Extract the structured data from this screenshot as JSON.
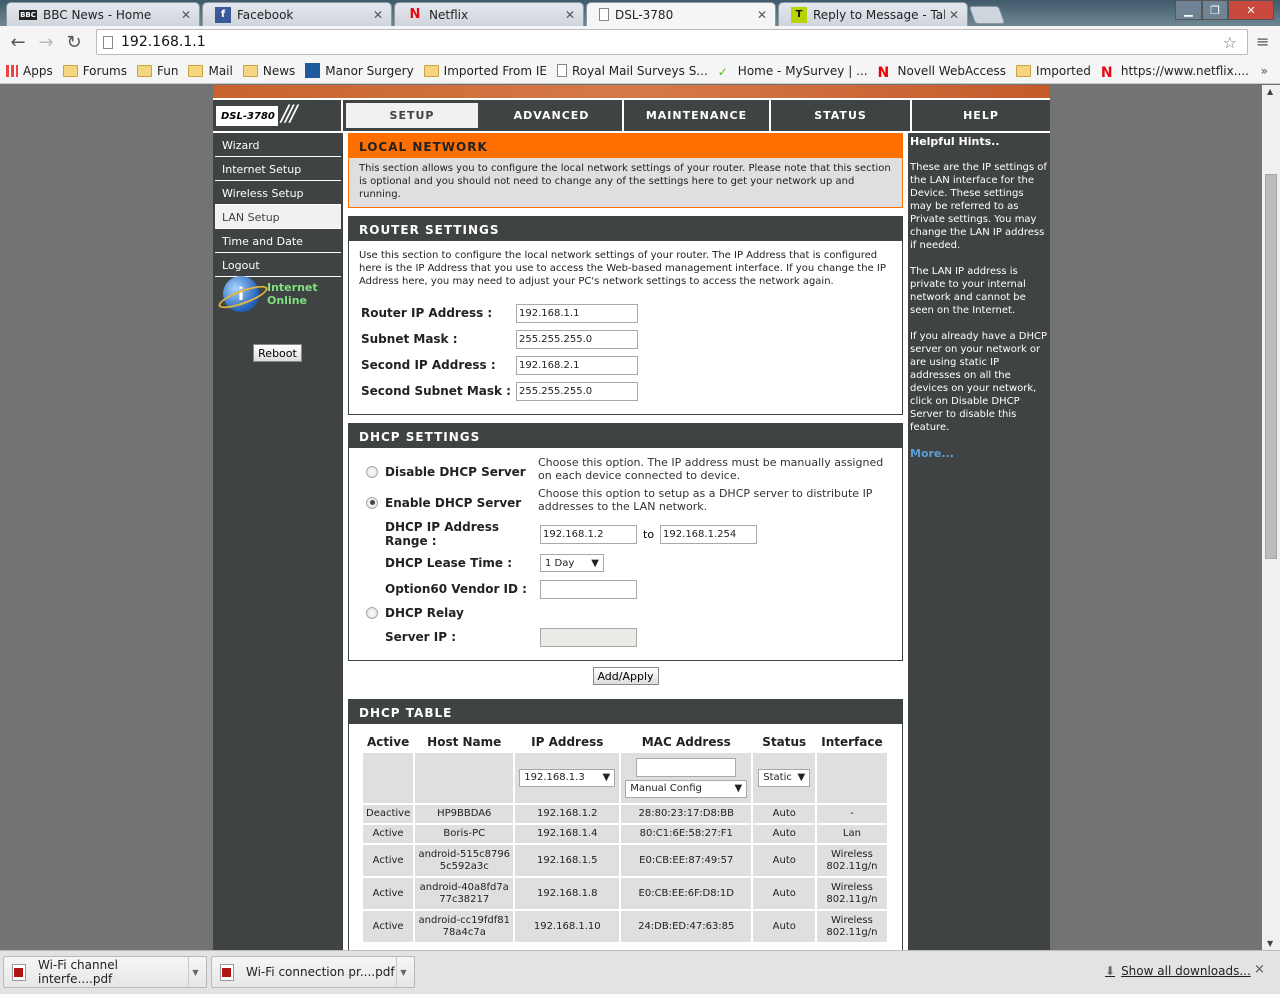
{
  "browser": {
    "tabs": [
      {
        "label": "BBC News - Home",
        "icon": "bbc-icon"
      },
      {
        "label": "Facebook",
        "icon": "facebook-icon"
      },
      {
        "label": "Netflix",
        "icon": "netflix-icon"
      },
      {
        "label": "DSL-3780",
        "icon": "page-icon",
        "active": true
      },
      {
        "label": "Reply to Message - TalkTa",
        "icon": "talktalk-icon"
      }
    ],
    "address": "192.168.1.1",
    "bookmarks": [
      {
        "label": "Apps",
        "icon": "apps-grid-icon"
      },
      {
        "label": "Forums",
        "icon": "folder-icon"
      },
      {
        "label": "Fun",
        "icon": "folder-icon"
      },
      {
        "label": "Mail",
        "icon": "folder-icon"
      },
      {
        "label": "News",
        "icon": "folder-icon"
      },
      {
        "label": "Manor Surgery",
        "icon": "surgery-icon"
      },
      {
        "label": "Imported From IE",
        "icon": "folder-icon"
      },
      {
        "label": "Royal Mail Surveys S...",
        "icon": "page-icon"
      },
      {
        "label": "Home - MySurvey | ...",
        "icon": "checkmark-icon"
      },
      {
        "label": "Novell WebAccess",
        "icon": "novell-icon"
      },
      {
        "label": "Imported",
        "icon": "folder-icon"
      },
      {
        "label": "https://www.netflix....",
        "icon": "netflix-icon"
      }
    ],
    "bookmarks_more": "»"
  },
  "router": {
    "model": "DSL-3780",
    "slashes": "///",
    "nav": [
      {
        "label": "SETUP",
        "active": true
      },
      {
        "label": "ADVANCED"
      },
      {
        "label": "MAINTENANCE"
      },
      {
        "label": "STATUS"
      },
      {
        "label": "HELP"
      }
    ],
    "sidebar": [
      {
        "label": "Wizard"
      },
      {
        "label": "Internet Setup"
      },
      {
        "label": "Wireless Setup"
      },
      {
        "label": "LAN Setup",
        "active": true
      },
      {
        "label": "Time and Date"
      },
      {
        "label": "Logout"
      }
    ],
    "status_line1": "Internet",
    "status_line2": "Online",
    "status_icon_glyph": "i",
    "reboot_label": "Reboot",
    "local_network": {
      "title": "LOCAL NETWORK",
      "desc": "This section allows you to configure the local network settings of your router. Please note that this section is optional and you should not need to change any of the settings here to get your network up and running."
    },
    "router_settings": {
      "title": "ROUTER SETTINGS",
      "desc": "Use this section to configure the local network settings of your router. The IP Address that is configured here is the IP Address that you use to access the Web-based management interface. If you change the IP Address here, you may need to adjust your PC's network settings to access the network again.",
      "fields": [
        {
          "label": "Router IP Address :",
          "value": "192.168.1.1"
        },
        {
          "label": "Subnet Mask :",
          "value": "255.255.255.0"
        },
        {
          "label": "Second IP Address :",
          "value": "192.168.2.1"
        },
        {
          "label": "Second Subnet Mask :",
          "value": "255.255.255.0"
        }
      ]
    },
    "dhcp_settings": {
      "title": "DHCP SETTINGS",
      "disable_label": "Disable DHCP Server",
      "disable_hint": "Choose this option. The IP address must be manually assigned on each device connected to device.",
      "enable_label": "Enable DHCP Server",
      "enable_hint": "Choose this option to setup as a DHCP server to distribute IP addresses to the LAN network.",
      "range_label": "DHCP IP Address Range :",
      "range_start": "192.168.1.2",
      "range_to": "to",
      "range_end": "192.168.1.254",
      "lease_label": "DHCP Lease Time :",
      "lease_value": "1 Day",
      "vendor_label": "Option60 Vendor ID :",
      "vendor_value": "",
      "relay_label": "DHCP Relay",
      "server_ip_label": "Server IP :",
      "server_ip_value": "",
      "selected": "enable"
    },
    "apply_label": "Add/Apply",
    "dhcp_table": {
      "title": "DHCP TABLE",
      "columns": [
        "Active",
        "Host Name",
        "IP Address",
        "MAC Address",
        "Status",
        "Interface"
      ],
      "input_row": {
        "ip_select": "192.168.1.3",
        "mac_input": "",
        "mac_select": "Manual Config",
        "status_select": "Static"
      },
      "rows": [
        {
          "active": "Deactive",
          "host": "HP9BBDA6",
          "ip": "192.168.1.2",
          "mac": "28:80:23:17:D8:BB",
          "status": "Auto",
          "iface": "-"
        },
        {
          "active": "Active",
          "host": "Boris-PC",
          "ip": "192.168.1.4",
          "mac": "80:C1:6E:58:27:F1",
          "status": "Auto",
          "iface": "Lan"
        },
        {
          "active": "Active",
          "host": "android-515c87965c592a3c",
          "ip": "192.168.1.5",
          "mac": "E0:CB:EE:87:49:57",
          "status": "Auto",
          "iface": "Wireless 802.11g/n"
        },
        {
          "active": "Active",
          "host": "android-40a8fd7a77c38217",
          "ip": "192.168.1.8",
          "mac": "E0:CB:EE:6F:D8:1D",
          "status": "Auto",
          "iface": "Wireless 802.11g/n"
        },
        {
          "active": "Active",
          "host": "android-cc19fdf8178a4c7a",
          "ip": "192.168.1.10",
          "mac": "24:DB:ED:47:63:85",
          "status": "Auto",
          "iface": "Wireless 802.11g/n"
        }
      ]
    },
    "help": {
      "title": "Helpful Hints..",
      "paragraphs": [
        "These are the IP settings of the LAN interface for the Device. These settings may be referred to as Private settings. You may change the LAN IP address if needed.",
        "The LAN IP address is private to your internal network and cannot be seen on the Internet.",
        "If you already have a DHCP server on your network or are using static IP addresses on all the devices on your network, click on Disable DHCP Server to disable this feature."
      ],
      "more": "More..."
    }
  },
  "downloads": {
    "items": [
      {
        "label": "Wi-Fi channel interfe....pdf"
      },
      {
        "label": "Wi-Fi connection pr....pdf"
      }
    ],
    "show_all": "Show all downloads...",
    "close": "×"
  },
  "colors": {
    "accent_orange": "#ff6f00",
    "dark_panel": "#404344",
    "active_link": "#1c22ff",
    "deactive_link": "#ff2020",
    "online_green": "#7fe07f"
  }
}
